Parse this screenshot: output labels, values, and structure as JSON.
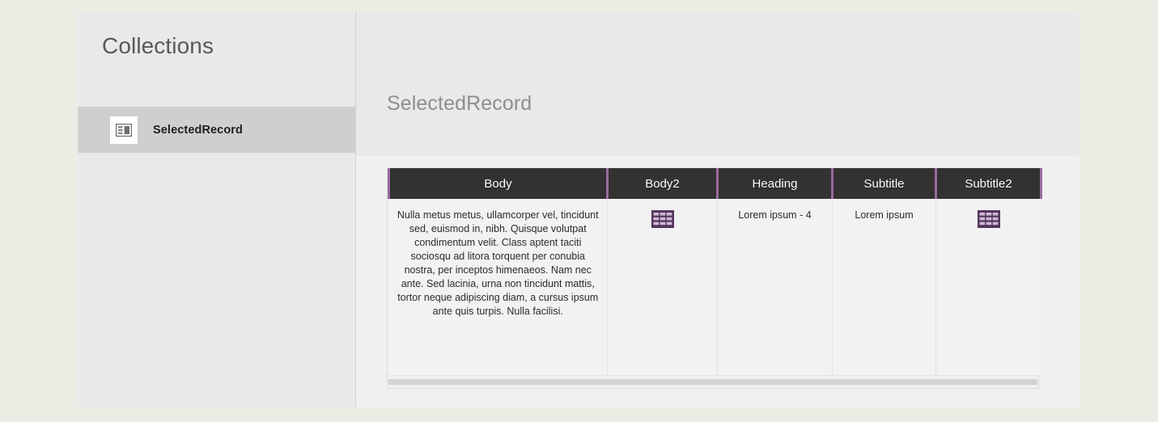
{
  "page": {
    "outer_background": "#edece4",
    "panel_background": "#e9e9e9",
    "grid_surface_background": "#f0f0f0",
    "header_background": "#333132",
    "accent_purple": "#9b6aa0",
    "icon_purple_dark": "#53345c",
    "icon_purple_light": "#c9b3cf"
  },
  "sidebar": {
    "title": "Collections",
    "items": [
      {
        "label": "SelectedRecord",
        "icon": "record-table-icon",
        "selected": true
      }
    ]
  },
  "main": {
    "title": "SelectedRecord",
    "scrollbar": {
      "orientation": "horizontal",
      "name": "grid-horizontal-scrollbar"
    }
  },
  "table_data": {
    "type": "table",
    "columns": [
      "Body",
      "Body2",
      "Heading",
      "Subtitle",
      "Subtitle2"
    ],
    "rows": [
      {
        "Body": "Nulla metus metus, ullamcorper vel, tincidunt sed, euismod in, nibh. Quisque volutpat condimentum velit. Class aptent taciti sociosqu ad litora torquent per conubia nostra, per inceptos himenaeos. Nam nec ante. Sed lacinia, urna non tincidunt mattis, tortor neque adipiscing diam, a cursus ipsum ante quis turpis. Nulla facilisi.",
        "Body2": "table-grid-icon",
        "Heading": "Lorem ipsum - 4",
        "Subtitle": "Lorem ipsum",
        "Subtitle2": "table-grid-icon"
      }
    ]
  }
}
